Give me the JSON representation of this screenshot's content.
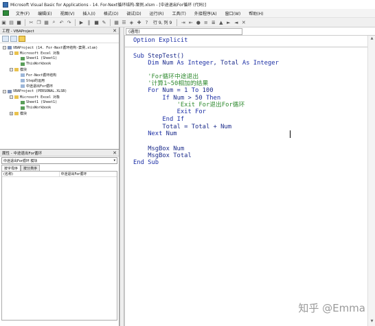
{
  "window": {
    "title": "Microsoft Visual Basic for Applications - 14. For-Next循环结构-案例.xlsm - [中途退出For循环 (代码)]"
  },
  "menu": {
    "items": [
      "文件(F)",
      "编辑(E)",
      "视图(V)",
      "插入(I)",
      "格式(O)",
      "调试(D)",
      "运行(R)",
      "工具(T)",
      "外接程序(A)",
      "窗口(W)",
      "帮助(H)"
    ]
  },
  "toolbar": {
    "cursor_position": "行 9, 列 9"
  },
  "project_panel": {
    "title": "工程 - VBAProject",
    "tree": [
      {
        "exp": "−",
        "icon": "proj",
        "label": "VBAProject (14. For-Next循环结构-案例.xlsm)"
      },
      {
        "exp": "−",
        "icon": "folder",
        "label": "Microsoft Excel 对象"
      },
      {
        "exp": "",
        "icon": "sheet",
        "label": "Sheet1 (Sheet1)"
      },
      {
        "exp": "",
        "icon": "sheet",
        "label": "ThisWorkbook"
      },
      {
        "exp": "−",
        "icon": "folder",
        "label": "模块"
      },
      {
        "exp": "",
        "icon": "mod",
        "label": "For-Next循环结构"
      },
      {
        "exp": "",
        "icon": "mod",
        "label": "Step的运用"
      },
      {
        "exp": "",
        "icon": "mod",
        "label": "中途退出For循环"
      },
      {
        "exp": "−",
        "icon": "proj",
        "label": "VBAProject (PERSONAL.XLSB)"
      },
      {
        "exp": "−",
        "icon": "folder",
        "label": "Microsoft Excel 对象"
      },
      {
        "exp": "",
        "icon": "sheet",
        "label": "Sheet1 (Sheet1)"
      },
      {
        "exp": "",
        "icon": "sheet",
        "label": "ThisWorkbook"
      },
      {
        "exp": "+",
        "icon": "folder",
        "label": "模块"
      }
    ]
  },
  "properties_panel": {
    "title": "属性 - 中途退出For循环",
    "object_combo": "中途退出For循环  模块",
    "tabs": [
      "按字母序",
      "按分类序"
    ],
    "rows": [
      {
        "key": "(名称)",
        "value": "中途退出For循环"
      }
    ]
  },
  "code_window": {
    "object_combo": "(通用)",
    "lines": [
      {
        "indent": 0,
        "parts": [
          [
            "kw",
            "Option Explicit"
          ]
        ]
      },
      {
        "indent": 0,
        "parts": [
          [
            "kw",
            "Sub "
          ],
          [
            "tx",
            "StepTest()"
          ]
        ]
      },
      {
        "indent": 2,
        "parts": [
          [
            "kw",
            "Dim "
          ],
          [
            "tx",
            "Num "
          ],
          [
            "kw",
            "As Integer"
          ],
          [
            "tx",
            ", Total "
          ],
          [
            "kw",
            "As Integer"
          ]
        ]
      },
      {
        "indent": 0,
        "parts": []
      },
      {
        "indent": 2,
        "parts": [
          [
            "cm",
            "'For循环中途退出"
          ]
        ]
      },
      {
        "indent": 2,
        "parts": [
          [
            "cm",
            "'计算1~50相加的结果"
          ]
        ]
      },
      {
        "indent": 2,
        "parts": [
          [
            "kw",
            "For "
          ],
          [
            "tx",
            "Num = 1 "
          ],
          [
            "kw",
            "To "
          ],
          [
            "tx",
            "100"
          ]
        ]
      },
      {
        "indent": 4,
        "parts": [
          [
            "kw",
            "If "
          ],
          [
            "tx",
            "Num > 50 "
          ],
          [
            "kw",
            "Then"
          ]
        ]
      },
      {
        "indent": 6,
        "parts": [
          [
            "cm",
            "'Exit For退出For循环"
          ]
        ]
      },
      {
        "indent": 6,
        "parts": [
          [
            "kw",
            "Exit For"
          ]
        ]
      },
      {
        "indent": 4,
        "parts": [
          [
            "kw",
            "End If"
          ]
        ]
      },
      {
        "indent": 4,
        "parts": [
          [
            "tx",
            "Total = Total + Num"
          ]
        ]
      },
      {
        "indent": 2,
        "parts": [
          [
            "kw",
            "Next "
          ],
          [
            "tx",
            "Num"
          ]
        ]
      },
      {
        "indent": 0,
        "parts": []
      },
      {
        "indent": 2,
        "parts": [
          [
            "tx",
            "MsgBox Num"
          ]
        ]
      },
      {
        "indent": 2,
        "parts": [
          [
            "tx",
            "MsgBox Total"
          ]
        ]
      },
      {
        "indent": 0,
        "parts": [
          [
            "kw",
            "End Sub"
          ]
        ]
      }
    ]
  },
  "watermark": "知乎 @Emma"
}
